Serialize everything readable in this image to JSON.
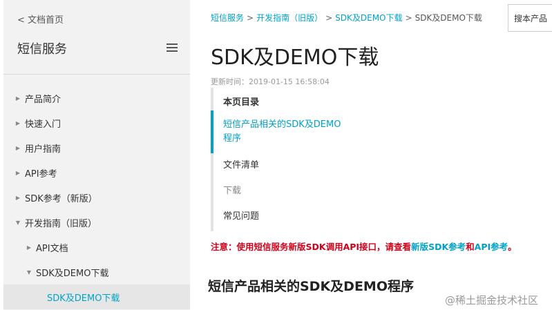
{
  "sidebar": {
    "back_label": "< 文档首页",
    "title": "短信服务",
    "menu_icon": "hamburger-icon",
    "items": [
      {
        "label": "产品简介",
        "arrow": "▶"
      },
      {
        "label": "快速入门",
        "arrow": "▶"
      },
      {
        "label": "用户指南",
        "arrow": "▶"
      },
      {
        "label": "API参考",
        "arrow": "▶"
      },
      {
        "label": "SDK参考（新版）",
        "arrow": "▶"
      },
      {
        "label": "开发指南（旧版）",
        "arrow": "▼"
      },
      {
        "label": "API文档",
        "arrow": "▶"
      },
      {
        "label": "SDK及DEMO下载",
        "arrow": "▼"
      },
      {
        "label": "SDK及DEMO下载",
        "arrow": ""
      }
    ]
  },
  "breadcrumb": {
    "items": [
      "短信服务",
      "开发指南（旧版）",
      "SDK及DEMO下载"
    ],
    "separator": ">",
    "current": "SDK及DEMO下载"
  },
  "search": {
    "value": "搜本产品"
  },
  "page": {
    "title": "SDK及DEMO下载",
    "updated": "更新时间：2019-01-15 16:58:04"
  },
  "toc": {
    "heading": "本页目录",
    "items": [
      {
        "line1": "短信产品相关的SDK及DEMO",
        "line2": "程序"
      },
      {
        "line1": "文件清单"
      },
      {
        "line1": "下载"
      },
      {
        "line1": "常见问题"
      }
    ]
  },
  "notice": {
    "prefix": "注意：使用短信服务新版SDK调用API接口，请查看",
    "link1": "新版SDK参考",
    "mid": "和",
    "link2": "API参考",
    "suffix": "。"
  },
  "section_heading": "短信产品相关的SDK及DEMO程序",
  "watermark": "@稀土掘金技术社区",
  "colors": {
    "accent": "#00a2ca",
    "warning": "#d0021b",
    "sidebar_bg": "#f2f2f2"
  }
}
